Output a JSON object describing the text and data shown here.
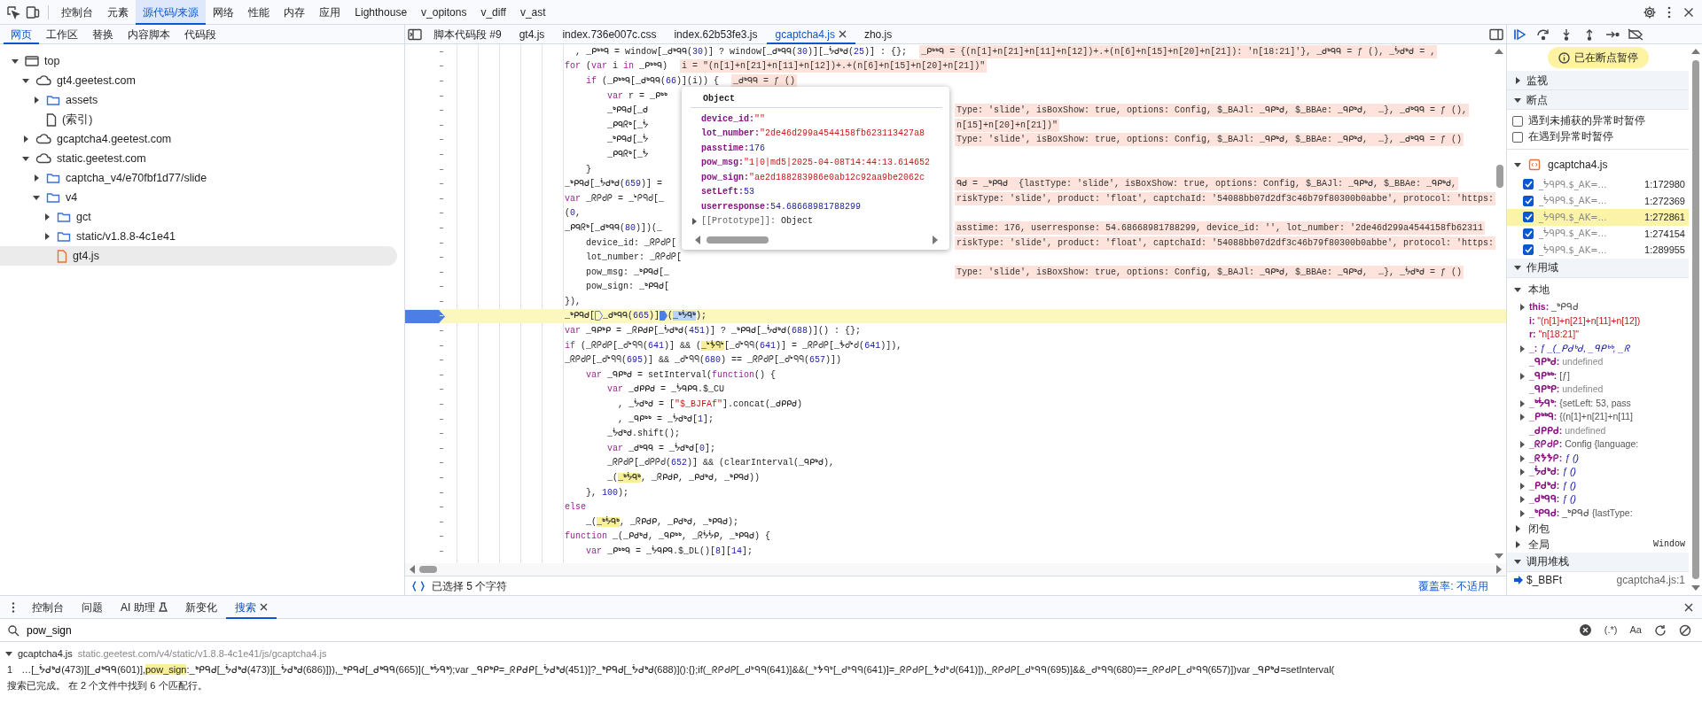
{
  "toolbar": {
    "tabs": [
      {
        "label": "控制台",
        "selected": false
      },
      {
        "label": "元素",
        "selected": false
      },
      {
        "label": "源代码/来源",
        "selected": true
      },
      {
        "label": "网络",
        "selected": false
      },
      {
        "label": "性能",
        "selected": false
      },
      {
        "label": "内存",
        "selected": false
      },
      {
        "label": "应用",
        "selected": false
      },
      {
        "label": "Lighthouse",
        "selected": false
      },
      {
        "label": "v_opitons",
        "selected": false
      },
      {
        "label": "v_diff",
        "selected": false
      },
      {
        "label": "v_ast",
        "selected": false
      }
    ]
  },
  "navigator": {
    "tabs": [
      {
        "label": "网页",
        "selected": true
      },
      {
        "label": "工作区",
        "selected": false
      },
      {
        "label": "替换",
        "selected": false
      },
      {
        "label": "内容脚本",
        "selected": false
      },
      {
        "label": "代码段",
        "selected": false
      }
    ],
    "tree": [
      {
        "label": "top",
        "kind": "frame",
        "expanded": true,
        "selected": false,
        "children": [
          {
            "label": "gt4.geetest.com",
            "kind": "domain",
            "expanded": true,
            "selected": false,
            "children": [
              {
                "label": "assets",
                "kind": "folder",
                "expanded": false,
                "selected": false
              },
              {
                "label": "(索引)",
                "kind": "file",
                "selected": false
              }
            ]
          },
          {
            "label": "gcaptcha4.geetest.com",
            "kind": "domain",
            "expanded": false,
            "selected": false
          },
          {
            "label": "static.geetest.com",
            "kind": "domain",
            "expanded": true,
            "selected": false,
            "children": [
              {
                "label": "captcha_v4/e70fbf1d77/slide",
                "kind": "folder",
                "expanded": false,
                "selected": false
              },
              {
                "label": "v4",
                "kind": "folder",
                "expanded": true,
                "selected": false,
                "children": [
                  {
                    "label": "gct",
                    "kind": "folder",
                    "expanded": false,
                    "selected": false
                  },
                  {
                    "label": "static/v1.8.8-4c1e41",
                    "kind": "folder",
                    "expanded": false,
                    "selected": false
                  },
                  {
                    "label": "gt4.js",
                    "kind": "script",
                    "selected": true
                  }
                ]
              }
            ]
          }
        ]
      }
    ]
  },
  "editor": {
    "tabs": [
      {
        "label": "脚本代码段 #9",
        "selected": false,
        "closable": false
      },
      {
        "label": "gt4.js",
        "selected": false,
        "closable": false
      },
      {
        "label": "index.736e007c.css",
        "selected": false,
        "closable": false
      },
      {
        "label": "index.62b53fe3.js",
        "selected": false,
        "closable": false
      },
      {
        "label": "gcaptcha4.js",
        "selected": true,
        "closable": true
      },
      {
        "label": "zho.js",
        "selected": false,
        "closable": false
      }
    ],
    "lines": [
      {
        "gutter": "–",
        "kind": "normal",
        "breakpoint": false,
        "current": false,
        "tokens": [
          {
            "kind": "plain",
            "text": "  , _ᑭᒃᒃᑫ = window[_ᑯᒃᑫᑫ("
          },
          {
            "kind": "number",
            "text": "30"
          },
          {
            "kind": "plain",
            "text": ")] ? window[_ᑯᒃᑫᑫ("
          },
          {
            "kind": "number",
            "text": "30"
          },
          {
            "kind": "plain",
            "text": ")][_ᖭᑯᒃᑯ("
          },
          {
            "kind": "number",
            "text": "25"
          },
          {
            "kind": "plain",
            "text": ")] : {};"
          }
        ],
        "inline": "_ᑭᒃᒃᑫ = {(n[1]+n[21]+n[11]+n[12])+.+(n[6]+n[15]+n[20]+n[21]): 'n[18:21]'}, _ᑯᒃᑫᑫ = ƒ (), _ᖭᑯᒃᑯ = ,"
      },
      {
        "gutter": "–",
        "kind": "normal",
        "breakpoint": false,
        "current": false,
        "tokens": [
          {
            "kind": "keyword",
            "text": "for"
          },
          {
            "kind": "plain",
            "text": " ("
          },
          {
            "kind": "keyword",
            "text": "var"
          },
          {
            "kind": "plain",
            "text": " i "
          },
          {
            "kind": "keyword",
            "text": "in"
          },
          {
            "kind": "plain",
            "text": " _ᑭᒃᒃᑫ)"
          }
        ],
        "inline": "i = \"(n[1]+n[21]+n[11]+n[12])+.+(n[6]+n[15]+n[20]+n[21])\""
      },
      {
        "gutter": "–",
        "kind": "normal",
        "breakpoint": false,
        "current": false,
        "tokens": [
          {
            "kind": "keyword",
            "text": "    if"
          },
          {
            "kind": "plain",
            "text": " (_ᑭᒃᒃᑫ[_ᑯᒃᑫᑫ("
          },
          {
            "kind": "number",
            "text": "66"
          },
          {
            "kind": "plain",
            "text": ")](i)) {"
          }
        ],
        "inline": "_ᑯᒃᑫᑫ = ƒ ()"
      },
      {
        "gutter": "–",
        "kind": "covered",
        "breakpoint": false,
        "current": false,
        "tokens": [
          {
            "kind": "keyword",
            "text": "        var"
          },
          {
            "kind": "plain",
            "text": " r = _ᑭᒃᒃ"
          }
        ]
      },
      {
        "gutter": "–",
        "kind": "covered",
        "breakpoint": false,
        "current": false,
        "tokens": [
          {
            "kind": "plain",
            "text": "        _ᒃᑭᑫᑯ[_ᑯ"
          }
        ],
        "inline": "Type: 'slide', isBoxShow: true, options: Config, $_BAJl: _ᑫᑭᒃᑯ, $_BBAe: _ᑫᑭᒃᑯ,  …}, _ᑯᒃᑫᑫ = ƒ (),"
      },
      {
        "gutter": "–",
        "kind": "covered",
        "breakpoint": false,
        "current": false,
        "tokens": [
          {
            "kind": "plain",
            "text": "        _ᑭᑫᖇᒃ[_ᖭ"
          }
        ],
        "inline": "n[15]+n[20]+n[21])\""
      },
      {
        "gutter": "–",
        "kind": "covered",
        "breakpoint": false,
        "current": false,
        "tokens": [
          {
            "kind": "plain",
            "text": "        _ᒃᑭᑫᑯ[_ᖭ"
          }
        ],
        "inline": "Type: 'slide', isBoxShow: true, options: Config, $_BAJl: _ᑫᑭᒃᑯ, $_BBAe: _ᑫᑭᒃᑯ,  …}, _ᑯᒃᑫᑫ = ƒ ()"
      },
      {
        "gutter": "–",
        "kind": "covered",
        "breakpoint": false,
        "current": false,
        "tokens": [
          {
            "kind": "plain",
            "text": "        _ᑭᑫᖇᒃ[_ᖭ"
          }
        ]
      },
      {
        "gutter": "–",
        "kind": "normal",
        "breakpoint": false,
        "current": false,
        "tokens": [
          {
            "kind": "plain",
            "text": "    }"
          }
        ]
      },
      {
        "gutter": "–",
        "kind": "covered",
        "breakpoint": false,
        "current": false,
        "tokens": [
          {
            "kind": "plain",
            "text": "_ᒃᑭᑫᑯ[_ᖭᑯᒃᑯ("
          },
          {
            "kind": "number",
            "text": "659"
          },
          {
            "kind": "plain",
            "text": ")] ="
          }
        ],
        "inline": "ᑫᑯ = _ᒃᑭᑫᑯ  {lastType: 'slide', isBoxShow: true, options: Config, $_BAJl: _ᑫᑭᒃᑯ, $_BBAe: _ᑫᑭᒃᑯ,"
      },
      {
        "gutter": "–",
        "kind": "covered",
        "breakpoint": false,
        "current": false,
        "tokens": [
          {
            "kind": "keyword",
            "text": "var"
          },
          {
            "kind": "plain",
            "text": " _ᖇᑭᑯᑭ = _ᒃᑭᑫᑯ[_"
          }
        ],
        "inline": "riskType: 'slide', product: 'float', captchaId: '54088bb07d2df3c46b79f80300b0abbe', protocol: 'https:"
      },
      {
        "gutter": "–",
        "kind": "normal",
        "breakpoint": false,
        "current": false,
        "tokens": [
          {
            "kind": "plain",
            "text": "("
          },
          {
            "kind": "number",
            "text": "0"
          },
          {
            "kind": "plain",
            "text": ","
          }
        ]
      },
      {
        "gutter": "–",
        "kind": "covered",
        "breakpoint": false,
        "current": false,
        "tokens": [
          {
            "kind": "plain",
            "text": "_ᑭᑫᖇᒃ[_ᑯᒃᑫᑫ("
          },
          {
            "kind": "number",
            "text": "80"
          },
          {
            "kind": "plain",
            "text": ")])(_"
          }
        ],
        "inline": "asstime: 176, userresponse: 54.68668981788299, device_id: '', lot_number: '2de46d299a4544158fb62311"
      },
      {
        "gutter": "–",
        "kind": "covered",
        "breakpoint": false,
        "current": false,
        "tokens": [
          {
            "kind": "plain",
            "text": "    device_id: _ᖇᑭᑯᑭ["
          }
        ],
        "inline": "riskType: 'slide', product: 'float', captchaId: '54088bb07d2df3c46b79f80300b0abbe', protocol: 'https:"
      },
      {
        "gutter": "–",
        "kind": "covered",
        "breakpoint": false,
        "current": false,
        "tokens": [
          {
            "kind": "plain",
            "text": "    lot_number: _ᖇᑭᑯᑭ["
          }
        ]
      },
      {
        "gutter": "–",
        "kind": "covered",
        "breakpoint": false,
        "current": false,
        "tokens": [
          {
            "kind": "plain",
            "text": "    pow_msg: _ᒃᑭᑫᑯ[_"
          }
        ],
        "inline": "Type: 'slide', isBoxShow: true, options: Config, $_BAJl: _ᑫᑭᒃᑯ, $_BBAe: _ᑫᑭᒃᑯ,  …}, _ᖭᑯᒃᑯ = ƒ ()"
      },
      {
        "gutter": "–",
        "kind": "covered",
        "breakpoint": false,
        "current": false,
        "tokens": [
          {
            "kind": "plain",
            "text": "    pow_sign: _ᒃᑭᑫᑯ["
          }
        ]
      },
      {
        "gutter": "–",
        "kind": "normal",
        "breakpoint": false,
        "current": false,
        "tokens": [
          {
            "kind": "plain",
            "text": "}),"
          }
        ]
      },
      {
        "gutter": "–",
        "kind": "normal",
        "breakpoint": true,
        "current": true,
        "tokens": [
          {
            "kind": "plain",
            "text": "_ᒃᑭᑫᑯ["
          },
          {
            "kind": "step",
            "filled": false
          },
          {
            "kind": "plain",
            "text": "_ᑯᒃᑫᑫ("
          },
          {
            "kind": "number",
            "text": "665"
          },
          {
            "kind": "plain",
            "text": ")]"
          },
          {
            "kind": "step",
            "filled": true
          },
          {
            "kind": "plain",
            "text": "("
          },
          {
            "kind": "selection",
            "text": "_ᒃᖭᑫᒃ"
          },
          {
            "kind": "plain",
            "text": ");"
          }
        ]
      },
      {
        "gutter": "–",
        "kind": "normal",
        "breakpoint": false,
        "current": false,
        "tokens": [
          {
            "kind": "keyword",
            "text": "var"
          },
          {
            "kind": "plain",
            "text": " _ᑫᑭᒃᑭ = _ᖇᑭᑯᑭ[_ᖭᑯᒃᑯ("
          },
          {
            "kind": "number",
            "text": "451"
          },
          {
            "kind": "plain",
            "text": ")] ? _ᒃᑭᑫᑯ[_ᖭᑯᒃᑯ("
          },
          {
            "kind": "number",
            "text": "688"
          },
          {
            "kind": "plain",
            "text": ")]() : {};"
          }
        ]
      },
      {
        "gutter": "–",
        "kind": "normal",
        "breakpoint": false,
        "current": false,
        "tokens": [
          {
            "kind": "keyword",
            "text": "if"
          },
          {
            "kind": "plain",
            "text": " (_ᖇᑭᑯᑭ[_ᑯᒃᑫᑫ("
          },
          {
            "kind": "number",
            "text": "641"
          },
          {
            "kind": "plain",
            "text": ")] && ("
          },
          {
            "kind": "match",
            "text": "_ᒃᖭᑫᒃ"
          },
          {
            "kind": "plain",
            "text": "[_ᑯᒃᑫᑫ("
          },
          {
            "kind": "number",
            "text": "641"
          },
          {
            "kind": "plain",
            "text": ")] = _ᖇᑭᑯᑭ[_ᖭᑯᒃᑯ("
          },
          {
            "kind": "number",
            "text": "641"
          },
          {
            "kind": "plain",
            "text": ")]),"
          }
        ]
      },
      {
        "gutter": "–",
        "kind": "normal",
        "breakpoint": false,
        "current": false,
        "tokens": [
          {
            "kind": "plain",
            "text": "_ᖇᑭᑯᑭ[_ᑯᒃᑫᑫ("
          },
          {
            "kind": "number",
            "text": "695"
          },
          {
            "kind": "plain",
            "text": ")] && _ᑯᒃᑫᑫ("
          },
          {
            "kind": "number",
            "text": "680"
          },
          {
            "kind": "plain",
            "text": ") == _ᖇᑭᑯᑭ[_ᑯᒃᑫᑫ("
          },
          {
            "kind": "number",
            "text": "657"
          },
          {
            "kind": "plain",
            "text": ")])"
          }
        ]
      },
      {
        "gutter": "–",
        "kind": "normal",
        "breakpoint": false,
        "current": false,
        "tokens": [
          {
            "kind": "keyword",
            "text": "    var"
          },
          {
            "kind": "plain",
            "text": " _ᑫᑭᒃᑯ = setInterval("
          },
          {
            "kind": "keyword",
            "text": "function"
          },
          {
            "kind": "plain",
            "text": "() {"
          }
        ]
      },
      {
        "gutter": "–",
        "kind": "normal",
        "breakpoint": false,
        "current": false,
        "tokens": [
          {
            "kind": "keyword",
            "text": "        var"
          },
          {
            "kind": "plain",
            "text": " _ᑯᑭᑭᑯ = _ᖭᑫᑭᑫ.$_CU"
          }
        ]
      },
      {
        "gutter": "–",
        "kind": "normal",
        "breakpoint": false,
        "current": false,
        "tokens": [
          {
            "kind": "plain",
            "text": "          , _ᖭᑯᒃᑯ = ["
          },
          {
            "kind": "string",
            "text": "\"$_BJFAf\""
          },
          {
            "kind": "plain",
            "text": "].concat(_ᑯᑭᑭᑯ)"
          }
        ]
      },
      {
        "gutter": "–",
        "kind": "normal",
        "breakpoint": false,
        "current": false,
        "tokens": [
          {
            "kind": "plain",
            "text": "          , _ᑫᑭᒃᒃ = _ᖭᑯᒃᑯ["
          },
          {
            "kind": "number",
            "text": "1"
          },
          {
            "kind": "plain",
            "text": "];"
          }
        ]
      },
      {
        "gutter": "–",
        "kind": "normal",
        "breakpoint": false,
        "current": false,
        "tokens": [
          {
            "kind": "plain",
            "text": "        _ᖭᑯᒃᑯ.shift();"
          }
        ]
      },
      {
        "gutter": "–",
        "kind": "normal",
        "breakpoint": false,
        "current": false,
        "tokens": [
          {
            "kind": "keyword",
            "text": "        var"
          },
          {
            "kind": "plain",
            "text": " _ᑯᒃᑫᑫ = _ᖭᑯᒃᑯ["
          },
          {
            "kind": "number",
            "text": "0"
          },
          {
            "kind": "plain",
            "text": "];"
          }
        ]
      },
      {
        "gutter": "–",
        "kind": "normal",
        "breakpoint": false,
        "current": false,
        "tokens": [
          {
            "kind": "plain",
            "text": "        _ᖇᑭᑯᑭ[_ᑯᑭᑭᑯ("
          },
          {
            "kind": "number",
            "text": "652"
          },
          {
            "kind": "plain",
            "text": ")] && (clearInterval(_ᑫᑭᒃᑯ),"
          }
        ]
      },
      {
        "gutter": "–",
        "kind": "normal",
        "breakpoint": false,
        "current": false,
        "tokens": [
          {
            "kind": "plain",
            "text": "        _("
          },
          {
            "kind": "match",
            "text": "_ᒃᖭᑫᒃ"
          },
          {
            "kind": "plain",
            "text": ", _ᖇᑭᑯᑭ, _ᑭᑯᒃᑯ, _ᒃᑭᑫᑯ))"
          }
        ]
      },
      {
        "gutter": "–",
        "kind": "normal",
        "breakpoint": false,
        "current": false,
        "tokens": [
          {
            "kind": "plain",
            "text": "    }, "
          },
          {
            "kind": "number",
            "text": "100"
          },
          {
            "kind": "plain",
            "text": ");"
          }
        ]
      },
      {
        "gutter": "–",
        "kind": "normal",
        "breakpoint": false,
        "current": false,
        "tokens": [
          {
            "kind": "keyword",
            "text": "else"
          }
        ]
      },
      {
        "gutter": "–",
        "kind": "normal",
        "breakpoint": false,
        "current": false,
        "tokens": [
          {
            "kind": "plain",
            "text": "    _("
          },
          {
            "kind": "match",
            "text": "_ᒃᖭᑫᒃ"
          },
          {
            "kind": "plain",
            "text": ", _ᖇᑭᑯᑭ, _ᑭᑯᒃᑯ, _ᒃᑭᑫᑯ);"
          }
        ]
      },
      {
        "gutter": "–",
        "kind": "normal",
        "breakpoint": false,
        "current": false,
        "tokens": [
          {
            "kind": "keyword",
            "text": "function"
          },
          {
            "kind": "plain",
            "text": " _(_ᑭᑯᒃᑯ, _ᑫᑭᒃᒃ, _ᖇᖭᖭᑭ, _ᒃᑭᑫᑯ) {"
          }
        ]
      },
      {
        "gutter": "–",
        "kind": "normal",
        "breakpoint": false,
        "current": false,
        "tokens": [
          {
            "kind": "keyword",
            "text": "    var"
          },
          {
            "kind": "plain",
            "text": " _ᑭᒃᒃᑫ = _ᖭᑫᑭᑫ.$_DL()["
          },
          {
            "kind": "number",
            "text": "8"
          },
          {
            "kind": "plain",
            "text": "]["
          },
          {
            "kind": "number",
            "text": "14"
          },
          {
            "kind": "plain",
            "text": "];"
          }
        ]
      }
    ],
    "popover": {
      "title": "Object",
      "props": [
        {
          "name": "device_id:",
          "value": "\"\"",
          "kind": "string"
        },
        {
          "name": "lot_number:",
          "value": "\"2de46d299a4544158fb623113427a8",
          "kind": "string"
        },
        {
          "name": "passtime:",
          "value": "176",
          "kind": "number"
        },
        {
          "name": "pow_msg:",
          "value": "\"1|0|md5|2025-04-08T14:44:13.614652",
          "kind": "string"
        },
        {
          "name": "pow_sign:",
          "value": "\"ae2d188283986e0ab12c92aa9be2062c",
          "kind": "string"
        },
        {
          "name": "setLeft:",
          "value": "53",
          "kind": "number"
        },
        {
          "name": "userresponse:",
          "value": "54.68668981788299",
          "kind": "number"
        }
      ],
      "prototype": {
        "name": "[[Prototype]]:",
        "value": "Object",
        "expanded": false
      }
    },
    "status": {
      "selection": "已选择 5 个字符",
      "coverage": "覆盖率: 不适用"
    }
  },
  "debugger": {
    "banner": "已在断点暂停",
    "watch": {
      "title": "监视",
      "expanded": false
    },
    "breakpoints": {
      "title": "断点",
      "expanded": true,
      "options": [
        {
          "label": "遇到未捕获的异常时暂停",
          "checked": false
        },
        {
          "label": "在遇到异常时暂停",
          "checked": false
        }
      ],
      "file": {
        "name": "gcaptcha4.js",
        "expanded": true
      },
      "items": [
        {
          "code": "_ᖭᑫᑭᑫ.$_AK=…",
          "location": "1:172980",
          "checked": true,
          "selected": false
        },
        {
          "code": "_ᖭᑫᑭᑫ.$_AK=…",
          "location": "1:272369",
          "checked": true,
          "selected": false
        },
        {
          "code": "_ᖭᑫᑭᑫ.$_AK=…",
          "location": "1:272861",
          "checked": true,
          "selected": true
        },
        {
          "code": "_ᖭᑫᑭᑫ.$_AK=…",
          "location": "1:274154",
          "checked": true,
          "selected": false
        },
        {
          "code": "_ᖭᑫᑭᑫ.$_AK=…",
          "location": "1:289955",
          "checked": true,
          "selected": false
        }
      ]
    },
    "scope": {
      "title": "作用域",
      "expanded": true,
      "local": {
        "title": "本地",
        "expanded": true,
        "vars": [
          {
            "name": "this:",
            "value": "_ᒃᑭᑫᑯ",
            "kind": "object",
            "expandable": true
          },
          {
            "name": "i:",
            "value": "\"(n[1]+n[21]+n[11]+n[12])",
            "kind": "string",
            "expandable": false
          },
          {
            "name": "r:",
            "value": "\"n[18:21]\"",
            "kind": "string",
            "expandable": false
          },
          {
            "name": "_:",
            "value": "ƒ _(_ᑭᑯᒃᑯ, _ᑫᑭᒃᒃ, _ᖇ",
            "kind": "function",
            "expandable": true
          },
          {
            "name": "_ᑫᑭᒃᑯ:",
            "value": "undefined",
            "kind": "undefined",
            "expandable": false
          },
          {
            "name": "_ᑫᑭᒃᒃ:",
            "value": "[ƒ]",
            "kind": "object",
            "expandable": true
          },
          {
            "name": "_ᑫᑭᒃᑭ:",
            "value": "undefined",
            "kind": "undefined",
            "expandable": false
          },
          {
            "name": "_ᒃᖭᑫᒃ:",
            "value": "{setLeft: 53, pass",
            "kind": "object",
            "expandable": true
          },
          {
            "name": "_ᑭᒃᒃᑫ:",
            "value": "{(n[1]+n[21]+n[11]",
            "kind": "object",
            "expandable": true
          },
          {
            "name": "_ᑯᑭᑭᑯ:",
            "value": "undefined",
            "kind": "undefined",
            "expandable": false
          },
          {
            "name": "_ᖇᑭᑯᑭ:",
            "value": "Config {language:",
            "kind": "object",
            "expandable": true
          },
          {
            "name": "_ᖇᖭᖭᑭ:",
            "value": "ƒ ()",
            "kind": "function",
            "expandable": true
          },
          {
            "name": "_ᖭᑯᒃᑯ:",
            "value": "ƒ ()",
            "kind": "function",
            "expandable": true
          },
          {
            "name": "_ᑭᑯᒃᑯ:",
            "value": "ƒ ()",
            "kind": "function",
            "expandable": true
          },
          {
            "name": "_ᑯᒃᑫᑫ:",
            "value": "ƒ ()",
            "kind": "function",
            "expandable": true
          },
          {
            "name": "_ᒃᑭᑫᑯ:",
            "value": "_ᒃᑭᑫᑯ {lastType:",
            "kind": "object",
            "expandable": true
          }
        ]
      },
      "others": [
        {
          "title": "闭包",
          "expanded": false
        },
        {
          "title": "全局",
          "expanded": false,
          "value": "Window"
        }
      ]
    },
    "call_stack": {
      "title": "调用堆栈",
      "expanded": true,
      "frames": [
        {
          "name": "$_BBFt",
          "location": "gcaptcha4.js:1",
          "current": true
        }
      ]
    }
  },
  "drawer": {
    "tabs": [
      {
        "label": "控制台",
        "selected": false,
        "closable": false
      },
      {
        "label": "问题",
        "selected": false,
        "closable": false
      },
      {
        "label": "AI 助理",
        "selected": false,
        "closable": false
      },
      {
        "label": "新变化",
        "selected": false,
        "closable": false
      },
      {
        "label": "搜索",
        "selected": true,
        "closable": true
      }
    ],
    "search": {
      "value": "pow_sign",
      "regex": "(.*)",
      "case": "Aa"
    },
    "results": [
      {
        "file": "gcaptcha4.js",
        "path": "static.geetest.com/v4/static/v1.8.8-4c1e41/js/gcaptcha4.js",
        "expanded": true,
        "matches": [
          {
            "line": "1",
            "before": "…[_ᖭᑯᒃᑯ(473)][_ᑯᒃᑫᑫ(601)],",
            "match": "pow_sign",
            "after": ":_ᒃᑭᑫᑯ[_ᖭᑯᒃᑯ(473)][_ᖭᑯᒃᑯ(686)]}),_ᒃᑭᑫᑯ[_ᑯᒃᑫᑫ(665)](_ᒃᖭᑫᒃ);var _ᑫᑭᒃᑭ=_ᖇᑭᑯᑭ[_ᖭᑯᒃᑯ(451)]?_ᒃᑭᑫᑯ[_ᖭᑯᒃᑯ(688)]():{};if(_ᖇᑭᑯᑭ[_ᑯᒃᑫᑫ(641)]&&(_ᒃᖭᑫᒃ[_ᑯᒃᑫᑫ(641)]=_ᖇᑭᑯᑭ[_ᖭᑯᒃᑯ(641)]),_ᖇᑭᑯᑭ[_ᑯᒃᑫᑫ(695)]&&_ᑯᒃᑫᑫ(680)==_ᖇᑭᑯᑭ[_ᑯᒃᑫᑫ(657)])var _ᑫᑭᒃᑯ=setInterval("
          }
        ]
      }
    ],
    "status": "搜索已完成。 在 2 个文件中找到 6 个匹配行。"
  }
}
